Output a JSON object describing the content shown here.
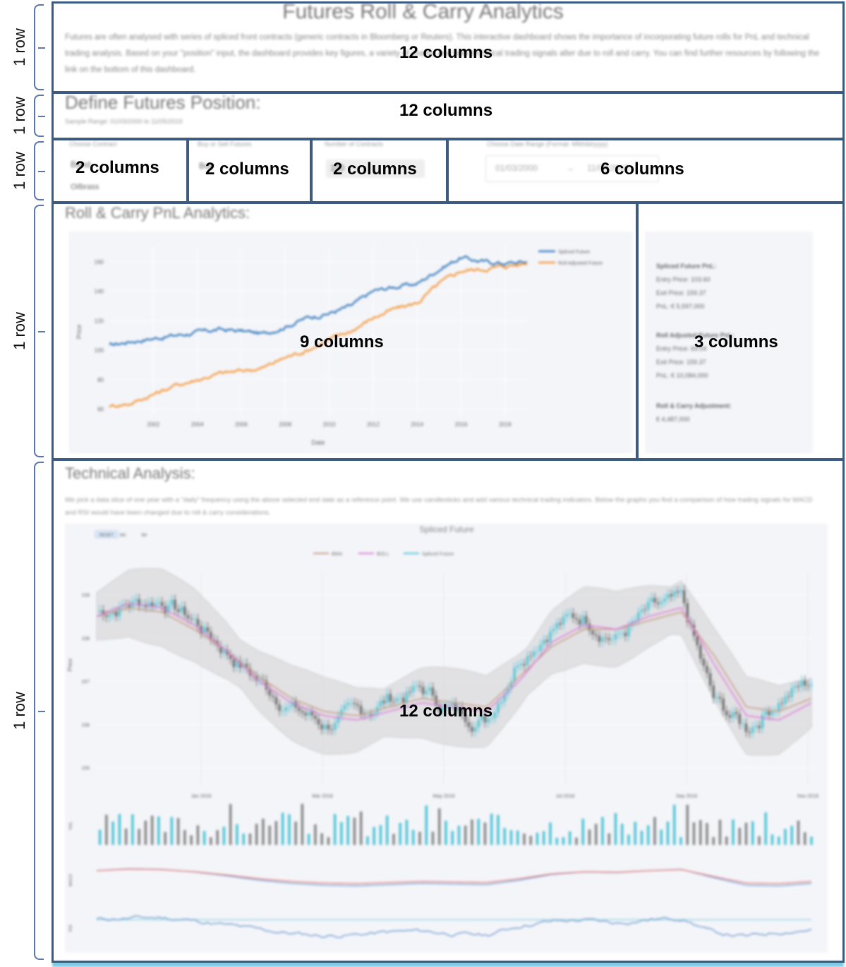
{
  "header": {
    "title": "Futures Roll & Carry Analytics",
    "description": "Futures are often analysed with series of spliced front contracts (generic contracts in Bloomberg or Reuters). This interactive dashboard shows the importance of incorporating future rolls for PnL and technical trading analysis. Based on your \"position\" input, the dashboard provides key figures, a variety of charts, and how technical trading signals alter due to roll and carry. You can find further resources by following the link on the bottom of this dashboard."
  },
  "position": {
    "title": "Define Futures Position:",
    "sample_range": "Sample Range: 01/03/2000 to 11/05/2019"
  },
  "controls": {
    "contract_label": "Choose Contract",
    "contract_value": "Bund",
    "contract_option2": "Oilbrass",
    "buysell_label": "Buy or Sell Futures",
    "buysell_value": "Buy",
    "contracts_label": "Number of Contracts",
    "contracts_value": "100",
    "date_label": "Choose Date Range (Format: MM/dd/yyyy)",
    "date_start": "01/03/2000",
    "date_arrow": "→",
    "date_end": "11/05/2019"
  },
  "pnl": {
    "title": "Roll & Carry PnL Analytics:",
    "ylabel": "Price",
    "xlabel": "Date",
    "legend": [
      "Spliced Future",
      "Roll Adjusted Future"
    ],
    "spliced_header": "Spliced Future PnL:",
    "spliced_entry": "Entry Price: 103.60",
    "spliced_exit": "Exit Price: 159.37",
    "spliced_pnl": "PnL: € 5,597,000",
    "roll_header": "Roll Adjusted Future PnL:",
    "roll_entry": "Entry Price: 69.04",
    "roll_exit": "Exit Price: 159.37",
    "roll_pnl": "PnL: € 10,084,000",
    "adj_header": "Roll & Carry Adjustment:",
    "adj_value": "€ 4,487,000"
  },
  "technical": {
    "title": "Technical Analysis:",
    "description": "We pick a data slice of one year with a \"daily\" frequency using the above selected end date as a reference point. We use candlesticks and add various technical trading indicators. Below the graphs you find a comparison of how trading signals for MACD and RSI would have been changed due to roll & carry considerations.",
    "chart_title": "Spliced Future",
    "buttons": [
      "RESET",
      "6M",
      "3M"
    ],
    "legend": [
      "BMA",
      "BOLL",
      "Spliced Future"
    ],
    "ylabel": "Price",
    "vol_label": "VOL",
    "macd_label": "MACD",
    "rsi_label": "RSI"
  },
  "colors": {
    "blue": "#3b7dbd",
    "orange": "#f59a40",
    "cyan": "#4ec5d6",
    "pink": "#e07ad6",
    "tan": "#c99b85",
    "frame": "#3d5a80"
  },
  "overlay": {
    "rows": [
      "1 row",
      "1 row",
      "1 row",
      "1 row",
      "1 row"
    ],
    "cols": [
      "12 columns",
      "12 columns",
      "2 columns",
      "2 columns",
      "2 columns",
      "6 columns",
      "9 columns",
      "3 columns",
      "12 columns"
    ]
  },
  "chart_data": [
    {
      "type": "line",
      "title": "",
      "xlabel": "Date",
      "ylabel": "Price",
      "x": [
        2000,
        2001,
        2002,
        2003,
        2004,
        2005,
        2006,
        2007,
        2008,
        2009,
        2010,
        2011,
        2012,
        2013,
        2014,
        2015,
        2016,
        2017,
        2018,
        2019
      ],
      "xticks": [
        "2002",
        "2004",
        "2006",
        "2008",
        "2010",
        "2012",
        "2014",
        "2016",
        "2018"
      ],
      "yticks": [
        "60",
        "80",
        "100",
        "120",
        "140",
        "160"
      ],
      "ylim": [
        55,
        170
      ],
      "series": [
        {
          "name": "Spliced Future",
          "values": [
            103,
            106,
            108,
            110,
            112,
            114,
            113,
            111,
            116,
            122,
            125,
            130,
            140,
            143,
            145,
            155,
            163,
            160,
            159,
            160
          ]
        },
        {
          "name": "Roll Adjusted Future",
          "values": [
            62,
            64,
            70,
            76,
            80,
            84,
            86,
            88,
            95,
            100,
            107,
            113,
            122,
            128,
            132,
            145,
            154,
            155,
            157,
            159
          ]
        }
      ]
    },
    {
      "type": "line",
      "title": "Spliced Future",
      "ylabel": "Price",
      "xticks": [
        "Jan 2018",
        "Mar 2018",
        "May 2018",
        "Jul 2018",
        "Sep 2018",
        "Nov 2018"
      ],
      "yticks": [
        "155",
        "156",
        "157",
        "158",
        "159"
      ],
      "ylim": [
        154.6,
        159.5
      ],
      "series": [
        {
          "name": "Spliced Future",
          "values": [
            158.6,
            158.8,
            158.9,
            158.4,
            157.7,
            157.0,
            156.4,
            156.0,
            156.2,
            156.6,
            156.8,
            156.3,
            156.1,
            157.6,
            158.3,
            158.5,
            158.0,
            158.6,
            158.8,
            156.5,
            155.9,
            156.6,
            157.0
          ]
        },
        {
          "name": "BMA",
          "values": [
            158.5,
            158.7,
            158.6,
            158.2,
            157.7,
            157.1,
            156.6,
            156.3,
            156.2,
            156.4,
            156.6,
            156.5,
            156.4,
            157.1,
            157.8,
            158.2,
            158.2,
            158.4,
            158.6,
            157.6,
            156.4,
            156.3,
            156.6
          ]
        },
        {
          "name": "BOLL",
          "values": [
            158.5,
            158.8,
            158.7,
            158.3,
            157.7,
            157.0,
            156.5,
            156.2,
            156.1,
            156.3,
            156.5,
            156.4,
            156.3,
            157.0,
            157.9,
            158.3,
            158.2,
            158.5,
            158.7,
            157.4,
            156.2,
            156.1,
            156.5
          ]
        }
      ]
    }
  ]
}
